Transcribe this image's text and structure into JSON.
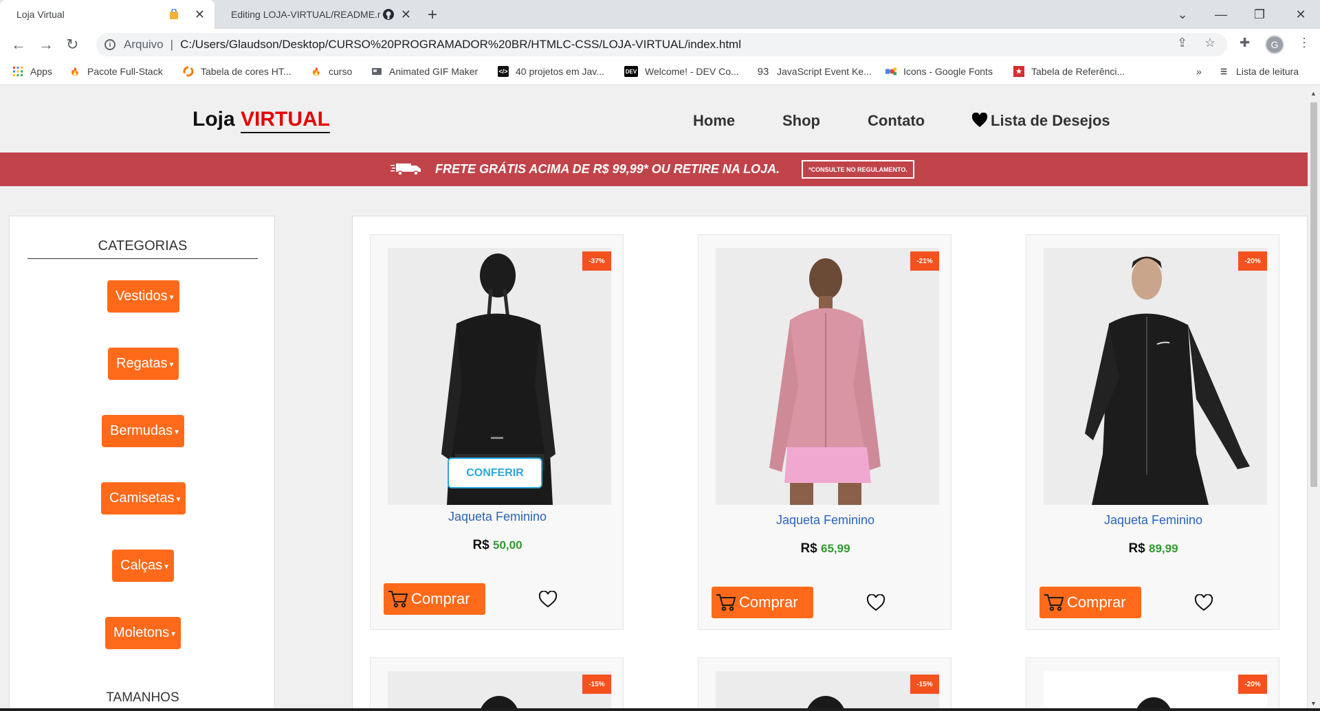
{
  "browser": {
    "tabs": [
      {
        "title": "Loja Virtual",
        "active": true
      },
      {
        "title": "Editing LOJA-VIRTUAL/README.r",
        "active": false
      }
    ],
    "new_tab": "+",
    "address": {
      "scheme": "Arquivo",
      "separator": "|",
      "url": "C:/Users/Glaudson/Desktop/CURSO%20PROGRAMADOR%20BR/HTMLC-CSS/LOJA-VIRTUAL/index.html"
    },
    "profile_initial": "G",
    "bookmarks": [
      {
        "label": "Apps",
        "icon": "apps-grid-icon"
      },
      {
        "label": "Pacote Full-Stack",
        "icon": "flame-icon"
      },
      {
        "label": "Tabela de cores HT...",
        "icon": "html-color-icon"
      },
      {
        "label": "curso",
        "icon": "flame-icon"
      },
      {
        "label": "Animated GIF Maker",
        "icon": "gif-icon"
      },
      {
        "label": "40 projetos em Jav...",
        "icon": "code-icon"
      },
      {
        "label": "Welcome! - DEV Co...",
        "icon": "dev-icon"
      },
      {
        "label": "JavaScript Event Ke...",
        "icon": "number-93-icon",
        "icon_text": "93"
      },
      {
        "label": "Icons - Google Fonts",
        "icon": "google-icons-icon"
      },
      {
        "label": "Tabela de Referênci...",
        "icon": "star-red-icon"
      }
    ],
    "bookmarks_overflow": "»",
    "reading_list": "Lista de leitura"
  },
  "site": {
    "logo_prefix": "Loja",
    "logo_highlight": "VIRTUAL",
    "nav": [
      "Home",
      "Shop",
      "Contato"
    ],
    "wishlist_label": "Lista de Desejos",
    "banner_text": "FRETE GRÁTIS ACIMA DE R$ 99,99* OU RETIRE NA LOJA.",
    "banner_button": "*CONSULTE NO REGULAMENTO."
  },
  "sidebar": {
    "title": "CATEGORIAS",
    "categories": [
      "Vestidos",
      "Regatas",
      "Bermudas",
      "Camisetas",
      "Calças",
      "Moletons"
    ],
    "next_section": "TAMANHOS"
  },
  "products": [
    {
      "name": "Jaqueta Feminino",
      "currency": "R$",
      "price": "50,00",
      "discount": "-37%",
      "variant": "black-back",
      "show_conferir": true
    },
    {
      "name": "Jaqueta Feminino",
      "currency": "R$",
      "price": "65,99",
      "discount": "-21%",
      "variant": "pink",
      "show_conferir": false
    },
    {
      "name": "Jaqueta Feminino",
      "currency": "R$",
      "price": "89,99",
      "discount": "-20%",
      "variant": "black-front",
      "show_conferir": false
    }
  ],
  "products_row2": [
    {
      "discount": "-15%"
    },
    {
      "discount": "-15%"
    },
    {
      "discount": "-20%"
    }
  ],
  "labels": {
    "conferir": "CONFERIR",
    "buy": "Comprar"
  },
  "colors": {
    "accent_orange": "#ff6a1a",
    "banner_red": "#c1434a",
    "badge": "#f4511e",
    "price_green": "#2e9b2e",
    "product_link": "#2a63b6",
    "conferir_blue": "#29a7e0"
  }
}
